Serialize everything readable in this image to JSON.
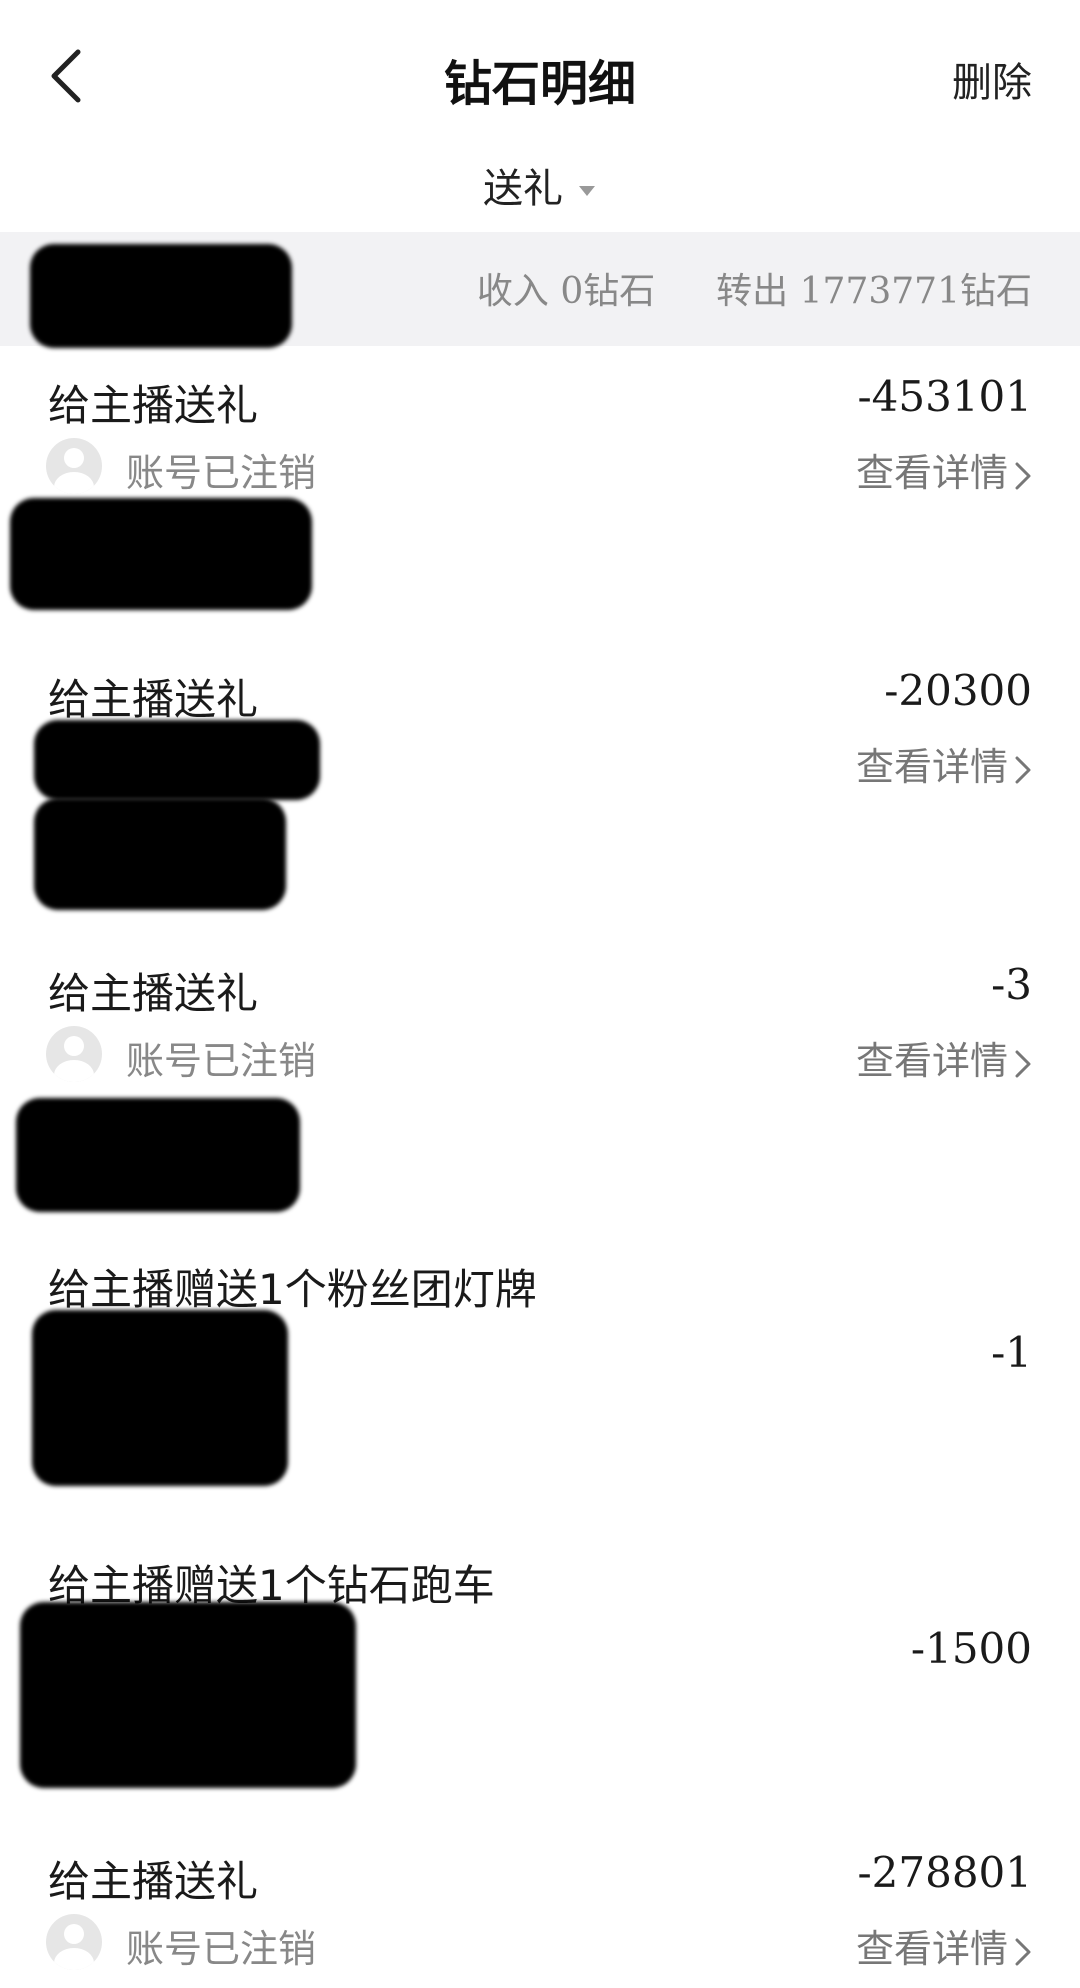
{
  "header": {
    "title": "钻石明细",
    "delete_label": "删除"
  },
  "filter": {
    "label": "送礼"
  },
  "summary": {
    "income_label": "收入",
    "income_value": "0",
    "income_unit": "钻石",
    "out_label": "转出",
    "out_value": "1773771",
    "out_unit": "钻石"
  },
  "records": [
    {
      "title": "给主播送礼",
      "amount": "-453101",
      "user": "账号已注销",
      "details": "查看详情"
    },
    {
      "title": "给主播送礼",
      "amount": "-20300",
      "details": "查看详情"
    },
    {
      "title": "给主播送礼",
      "amount": "-3",
      "user": "账号已注销",
      "details": "查看详情"
    },
    {
      "title": "给主播赠送1个粉丝团灯牌",
      "amount": "-1"
    },
    {
      "title": "给主播赠送1个钻石跑车",
      "amount": "-1500"
    },
    {
      "title": "给主播送礼",
      "amount": "-278801",
      "user": "账号已注销",
      "details": "查看详情"
    }
  ],
  "colors": {
    "summary_bg": "#f2f2f4",
    "muted_text": "#888888",
    "redaction": "#000000"
  }
}
